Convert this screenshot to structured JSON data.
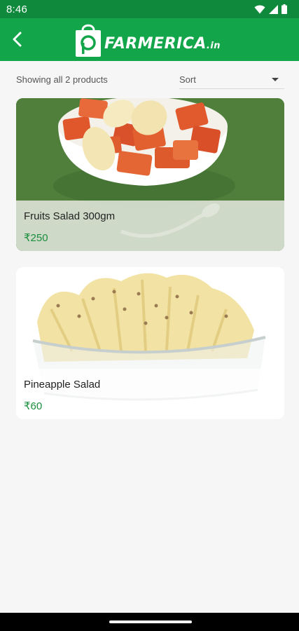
{
  "status_bar": {
    "time": "8:46",
    "icons": [
      "wifi-icon",
      "signal-icon",
      "battery-icon"
    ]
  },
  "app_bar": {
    "back_icon": "arrow-back-icon",
    "logo_text": "FARMERICA",
    "logo_tld": ".in",
    "color": "#12a54a"
  },
  "toolbar": {
    "result_count": "Showing all 2 products",
    "sort_label": "Sort"
  },
  "products": [
    {
      "title": "Fruits Salad 300gm",
      "price": "₹250"
    },
    {
      "title": "Pineapple Salad",
      "price": "₹60"
    }
  ],
  "theme": {
    "primary": "#12a54a",
    "status": "#0f8a3c",
    "price": "#1a8f3e"
  }
}
